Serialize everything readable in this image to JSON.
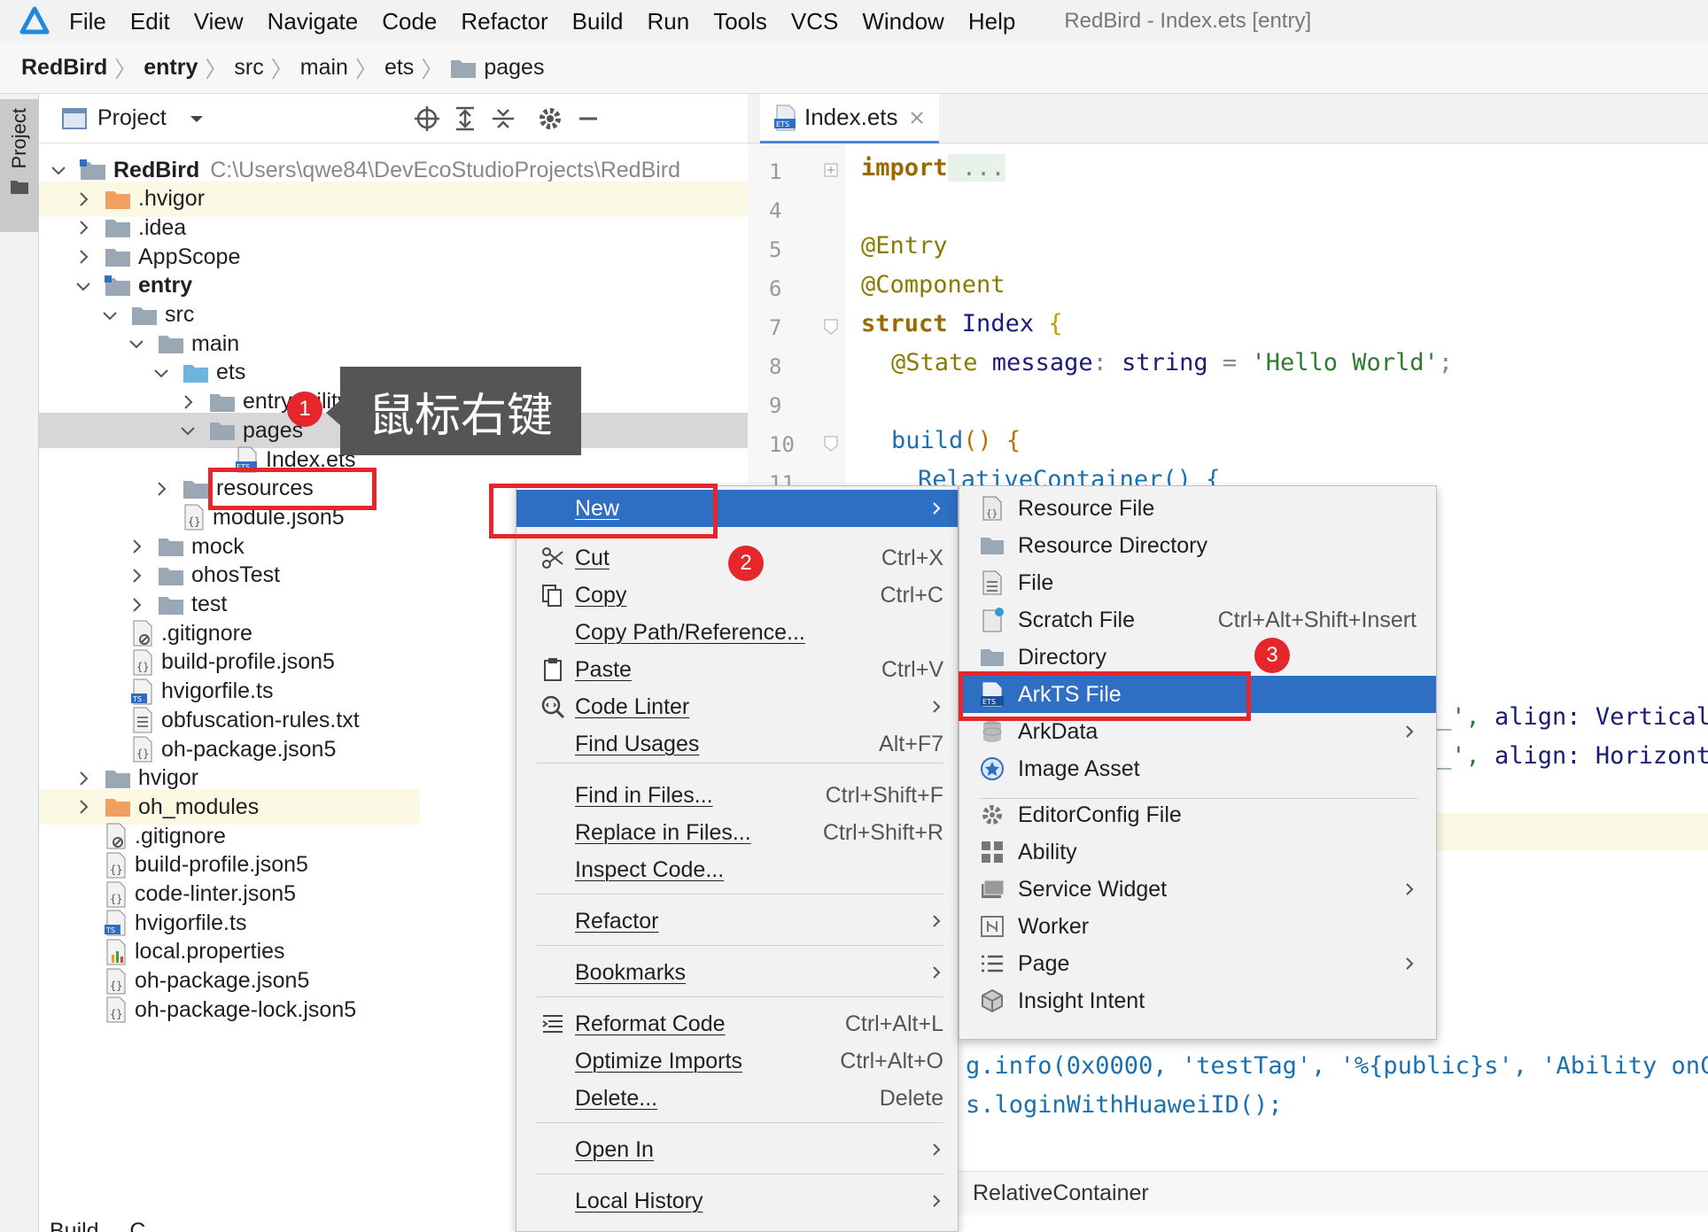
{
  "menubar": {
    "items": [
      "File",
      "Edit",
      "View",
      "Navigate",
      "Code",
      "Refactor",
      "Build",
      "Run",
      "Tools",
      "VCS",
      "Window",
      "Help"
    ],
    "window_title": "RedBird - Index.ets [entry]"
  },
  "breadcrumb": [
    "RedBird",
    "entry",
    "src",
    "main",
    "ets",
    "pages"
  ],
  "side_tab": "Project",
  "project_panel": {
    "title": "Project",
    "tree": [
      {
        "label": "RedBird",
        "path": "C:\\Users\\qwe84\\DevEcoStudioProjects\\RedBird"
      },
      {
        "label": ".hvigor"
      },
      {
        "label": ".idea"
      },
      {
        "label": "AppScope"
      },
      {
        "label": "entry"
      },
      {
        "label": "src"
      },
      {
        "label": "main"
      },
      {
        "label": "ets"
      },
      {
        "label": "entryability"
      },
      {
        "label": "pages"
      },
      {
        "label": "Index.ets"
      },
      {
        "label": "resources"
      },
      {
        "label": "module.json5"
      },
      {
        "label": "mock"
      },
      {
        "label": "ohosTest"
      },
      {
        "label": "test"
      },
      {
        "label": ".gitignore"
      },
      {
        "label": "build-profile.json5"
      },
      {
        "label": "hvigorfile.ts"
      },
      {
        "label": "obfuscation-rules.txt"
      },
      {
        "label": "oh-package.json5"
      },
      {
        "label": "hvigor"
      },
      {
        "label": "oh_modules"
      },
      {
        "label": ".gitignore"
      },
      {
        "label": "build-profile.json5"
      },
      {
        "label": "code-linter.json5"
      },
      {
        "label": "hvigorfile.ts"
      },
      {
        "label": "local.properties"
      },
      {
        "label": "oh-package.json5"
      },
      {
        "label": "oh-package-lock.json5"
      }
    ],
    "bottom_cut": "Build ... C"
  },
  "editor": {
    "tab": "Index.ets",
    "line_numbers": [
      "1",
      "4",
      "5",
      "6",
      "7",
      "8",
      "9",
      "10",
      "11"
    ],
    "code": {
      "l1_kw": "import",
      "l1_rest": " ...",
      "l5": "@Entry",
      "l6": "@Component",
      "l7_kw": "struct",
      "l7_name": " Index ",
      "l7_brace": "{",
      "l8_ann": "@State",
      "l8_name": " message",
      "l8_colon": ": ",
      "l8_type": "string",
      "l8_eq": " = ",
      "l8_str": "'Hello World'",
      "l8_end": ";",
      "l10_fn": "build",
      "l10_rest": "() {",
      "l11": "RelativeContainer() {",
      "r1_a": "_', ",
      "r1_b": "align: ",
      "r1_c": "Vertical",
      "r2_a": "_', ",
      "r2_b": "align: ",
      "r2_c": "Horizont",
      "r3": "g.info(0x0000, 'testTag', '%{public}s', 'Ability onC",
      "r4": "s.loginWithHuaweiID();"
    },
    "status_crumb": "RelativeContainer"
  },
  "context_menu": {
    "items": [
      {
        "label": "New",
        "shortcut": "",
        "submenu": true
      },
      {
        "label": "Cut",
        "shortcut": "Ctrl+X"
      },
      {
        "label": "Copy",
        "shortcut": "Ctrl+C"
      },
      {
        "label": "Copy Path/Reference...",
        "shortcut": ""
      },
      {
        "label": "Paste",
        "shortcut": "Ctrl+V"
      },
      {
        "label": "Code Linter",
        "shortcut": "",
        "submenu": true
      },
      {
        "label": "Find Usages",
        "shortcut": "Alt+F7"
      },
      {
        "label": "Find in Files...",
        "shortcut": "Ctrl+Shift+F"
      },
      {
        "label": "Replace in Files...",
        "shortcut": "Ctrl+Shift+R"
      },
      {
        "label": "Inspect Code...",
        "shortcut": ""
      },
      {
        "label": "Refactor",
        "shortcut": "",
        "submenu": true
      },
      {
        "label": "Bookmarks",
        "shortcut": "",
        "submenu": true
      },
      {
        "label": "Reformat Code",
        "shortcut": "Ctrl+Alt+L"
      },
      {
        "label": "Optimize Imports",
        "shortcut": "Ctrl+Alt+O"
      },
      {
        "label": "Delete...",
        "shortcut": "Delete"
      },
      {
        "label": "Open In",
        "shortcut": "",
        "submenu": true
      },
      {
        "label": "Local History",
        "shortcut": "",
        "submenu": true
      }
    ]
  },
  "new_submenu": {
    "items": [
      {
        "label": "Resource File"
      },
      {
        "label": "Resource Directory"
      },
      {
        "label": "File"
      },
      {
        "label": "Scratch File",
        "shortcut": "Ctrl+Alt+Shift+Insert"
      },
      {
        "label": "Directory"
      },
      {
        "label": "ArkTS File"
      },
      {
        "label": "ArkData",
        "submenu": true
      },
      {
        "label": "Image Asset"
      },
      {
        "label": "EditorConfig File"
      },
      {
        "label": "Ability"
      },
      {
        "label": "Service Widget",
        "submenu": true
      },
      {
        "label": "Worker"
      },
      {
        "label": "Page",
        "submenu": true
      },
      {
        "label": "Insight Intent"
      }
    ]
  },
  "annotations": {
    "tooltip": "鼠标右键",
    "badge1": "1",
    "badge2": "2",
    "badge3": "3"
  },
  "colors": {
    "accent": "#2f6fc3",
    "highlight_red": "#e5262a",
    "folder": "#9aa7b4",
    "folder_special": "#6fb3e0",
    "folder_orange": "#f0a060"
  }
}
